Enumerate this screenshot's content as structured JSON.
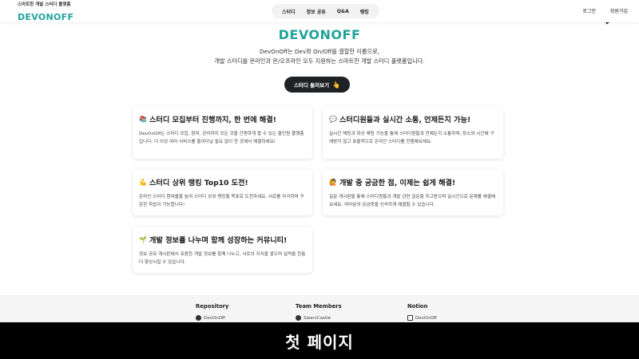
{
  "header": {
    "tagline": "스마트한 개발 스터디 플랫폼",
    "logo": "DEVONOFF",
    "nav": [
      "스터디",
      "정보 공유",
      "Q&A",
      "랭킹"
    ],
    "login": "로그인",
    "signup": "회원가입"
  },
  "hero": {
    "logo": "DEVONOFF",
    "line1": "DevOnOff는 Dev와 On/Off를 결합한 이름으로,",
    "line2": "개발 스터디를 온라인과 온/오프라인 모두 지원하는 스마트한 개발 스터디 플랫폼입니다.",
    "cta_label": "스터디 둘러보기",
    "cta_icon": "👆"
  },
  "cards": [
    {
      "icon": "📚",
      "title": "스터디 모집부터 진행까지, 한 번에 해결!",
      "desc": "DevOnOff는 스터디 모집, 참여, 관리까지 모든 것을 간편하게 할 수 있는 올인원 플랫폼입니다. 더 이상 여러 서비스를 돌아다닐 필요 없이 한 곳에서 해결하세요!"
    },
    {
      "icon": "💬",
      "title": "스터디원들과 실시간 소통, 언제든지 가능!",
      "desc": "실시간 채팅과 화상 채팅 기능을 통해 스터디원들과 언제든지 소통하며, 장소와 시간에 구애받지 않고 효율적으로 온라인 스터디를 진행해보세요."
    },
    {
      "icon": "💪",
      "title": "스터디 상위 랭킹 Top10 도전!",
      "desc": "온라인 스터디 참여율을 높여 스터디 상위 랭킹을 목표로 도전하세요. 서로를 자극하며 꾸준한 학습이 가능합니다!"
    },
    {
      "icon": "🙋",
      "title": "개발 중 궁금한 점, 이제는 쉽게 해결!",
      "desc": "질문 게시판을 통해 스터디원들과 개발 관련 질문을 주고받으며 실시간으로 문제를 해결해보세요. 여러분의 궁금증을 신속하게 해결할 수 있습니다."
    },
    {
      "icon": "🌱",
      "title": "개발 정보를 나누며 함께 성장하는 커뮤니티!",
      "desc": "정보 공유 게시판에서 유용한 개발 정보를 함께 나누고, 서로의 지식을 쌓으며 실력을 한층 더 향상시킬 수 있습니다."
    }
  ],
  "footer": {
    "repository": {
      "heading": "Repository",
      "link": "DevOnOff"
    },
    "team": {
      "heading": "Team Members",
      "link": "SwarvCastle"
    },
    "notion": {
      "heading": "Notion",
      "link": "DevOnOff"
    }
  },
  "caption": "첫 페이지"
}
